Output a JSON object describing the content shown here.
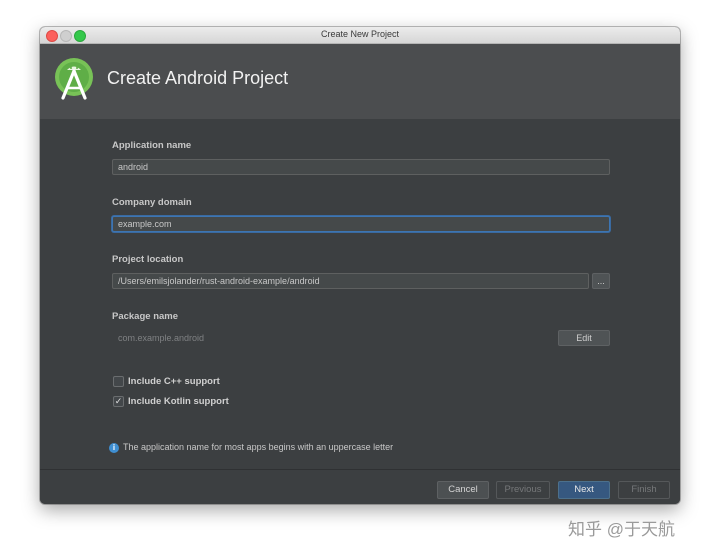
{
  "window": {
    "title": "Create New Project"
  },
  "header": {
    "title": "Create Android Project",
    "logo_icon": "android-studio-logo-icon"
  },
  "form": {
    "app_name": {
      "label": "Application name",
      "value": "android"
    },
    "company_domain": {
      "label": "Company domain",
      "value": "example.com"
    },
    "project_location": {
      "label": "Project location",
      "value": "/Users/emilsjolander/rust-android-example/android",
      "browse_label": "..."
    },
    "package_name": {
      "label": "Package name",
      "value": "com.example.android",
      "edit_label": "Edit"
    },
    "include_cpp": {
      "label": "Include C++ support",
      "checked": false
    },
    "include_kotlin": {
      "label": "Include Kotlin support",
      "checked": true,
      "check_glyph": "✓"
    }
  },
  "info": {
    "icon": "info-icon",
    "glyph": "i",
    "text": "The application name for most apps begins with an uppercase letter"
  },
  "footer": {
    "cancel": "Cancel",
    "previous": "Previous",
    "next": "Next",
    "finish": "Finish"
  },
  "watermark": "知乎 @于天航",
  "colors": {
    "accent": "#365880",
    "focus": "#3d75b2",
    "background": "#3c3f41",
    "header": "#4b4d4f"
  }
}
